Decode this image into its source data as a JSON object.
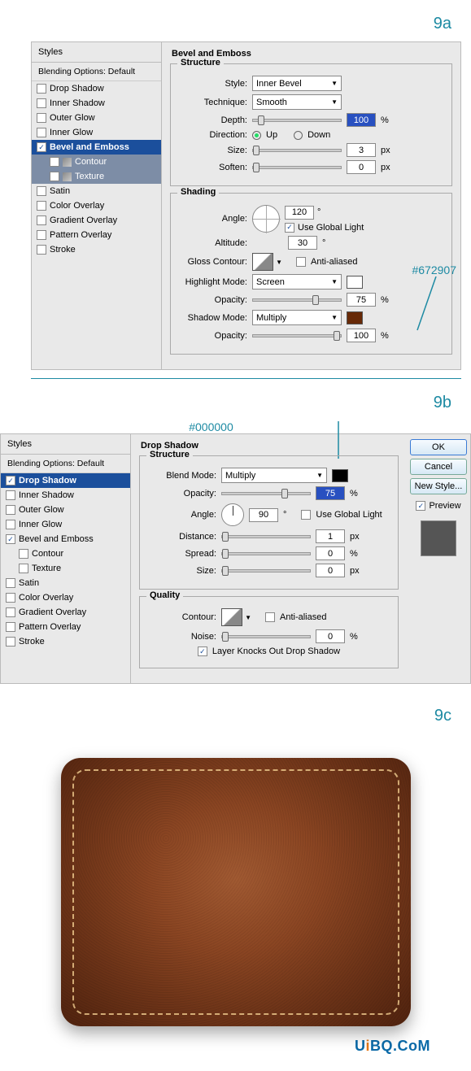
{
  "stepLabels": {
    "a": "9a",
    "b": "9b",
    "c": "9c"
  },
  "styles": {
    "header": "Styles",
    "blending": "Blending Options: Default",
    "items": [
      {
        "label": "Drop Shadow",
        "checked_a": false,
        "checked_b": true,
        "selected_b": true
      },
      {
        "label": "Inner Shadow",
        "checked_a": false,
        "checked_b": false
      },
      {
        "label": "Outer Glow",
        "checked_a": false,
        "checked_b": false
      },
      {
        "label": "Inner Glow",
        "checked_a": false,
        "checked_b": false
      },
      {
        "label": "Bevel and Emboss",
        "checked_a": true,
        "selected_a": true,
        "checked_b": true
      },
      {
        "label": "Contour",
        "sub": true,
        "checked_a": false,
        "checked_b": false
      },
      {
        "label": "Texture",
        "sub": true,
        "checked_a": false,
        "checked_b": false
      },
      {
        "label": "Satin",
        "checked_a": false,
        "checked_b": false
      },
      {
        "label": "Color Overlay",
        "checked_a": false,
        "checked_b": false
      },
      {
        "label": "Gradient Overlay",
        "checked_a": false,
        "checked_b": false
      },
      {
        "label": "Pattern Overlay",
        "checked_a": false,
        "checked_b": false
      },
      {
        "label": "Stroke",
        "checked_a": false,
        "checked_b": false
      }
    ]
  },
  "bevel": {
    "title": "Bevel and Emboss",
    "structure": {
      "legend": "Structure",
      "style_label": "Style:",
      "style_value": "Inner Bevel",
      "technique_label": "Technique:",
      "technique_value": "Smooth",
      "depth_label": "Depth:",
      "depth_value": "100",
      "depth_unit": "%",
      "direction_label": "Direction:",
      "up": "Up",
      "down": "Down",
      "size_label": "Size:",
      "size_value": "3",
      "size_unit": "px",
      "soften_label": "Soften:",
      "soften_value": "0",
      "soften_unit": "px"
    },
    "shading": {
      "legend": "Shading",
      "angle_label": "Angle:",
      "angle_value": "120",
      "deg": "°",
      "global_light": "Use Global Light",
      "altitude_label": "Altitude:",
      "altitude_value": "30",
      "gloss_label": "Gloss Contour:",
      "antialiased": "Anti-aliased",
      "highlight_label": "Highlight Mode:",
      "highlight_value": "Screen",
      "highlight_opacity_label": "Opacity:",
      "highlight_opacity": "75",
      "pct": "%",
      "shadow_label": "Shadow Mode:",
      "shadow_value": "Multiply",
      "shadow_opacity_label": "Opacity:",
      "shadow_opacity": "100",
      "shadow_color": "#672907",
      "highlight_color": "#ffffff",
      "hint": "#672907"
    }
  },
  "drop": {
    "title": "Drop Shadow",
    "hint": "#000000",
    "structure": {
      "legend": "Structure",
      "blend_label": "Blend Mode:",
      "blend_value": "Multiply",
      "blend_color": "#000000",
      "opacity_label": "Opacity:",
      "opacity_value": "75",
      "pct": "%",
      "angle_label": "Angle:",
      "angle_value": "90",
      "deg": "°",
      "global_light": "Use Global Light",
      "distance_label": "Distance:",
      "distance_value": "1",
      "px": "px",
      "spread_label": "Spread:",
      "spread_value": "0",
      "size_label": "Size:",
      "size_value": "0"
    },
    "quality": {
      "legend": "Quality",
      "contour_label": "Contour:",
      "antialiased": "Anti-aliased",
      "noise_label": "Noise:",
      "noise_value": "0",
      "pct": "%",
      "knockout": "Layer Knocks Out Drop Shadow"
    }
  },
  "buttons": {
    "ok": "OK",
    "cancel": "Cancel",
    "newstyle": "New Style...",
    "preview": "Preview"
  },
  "watermark": "U BQ.CoM",
  "watermark_i": "i"
}
